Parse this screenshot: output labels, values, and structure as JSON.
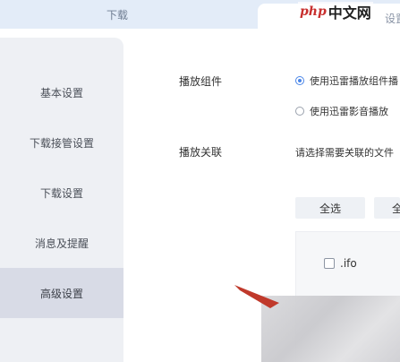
{
  "tabs": {
    "download": "下载",
    "settings": "设置"
  },
  "watermark": {
    "mark": "php",
    "text": "中文网"
  },
  "sidebar": {
    "items": [
      {
        "label": "基本设置"
      },
      {
        "label": "下载接管设置"
      },
      {
        "label": "下载设置"
      },
      {
        "label": "消息及提醒"
      },
      {
        "label": "高级设置"
      }
    ],
    "active_index": 4
  },
  "main": {
    "player_component": {
      "label": "播放组件",
      "options": [
        {
          "text": "使用迅雷播放组件播",
          "checked": true
        },
        {
          "text": "使用迅雷影音播放",
          "checked": false
        }
      ]
    },
    "playback_assoc": {
      "label": "播放关联",
      "prompt": "请选择需要关联的文件",
      "select_all": "全选",
      "select_all_2": "全",
      "file_types": [
        {
          "ext": ".ifo",
          "checked": false
        }
      ]
    }
  },
  "colors": {
    "accent": "#4a86e8",
    "sidebar_bg": "#eef0f4",
    "sidebar_active": "#d8dbe6",
    "topbar_bg": "#e3ecf8",
    "arrow": "#c0392b"
  }
}
